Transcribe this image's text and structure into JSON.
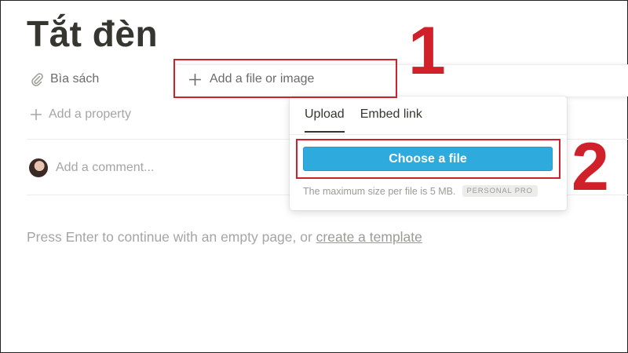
{
  "page": {
    "title": "Tắt đèn",
    "properties": {
      "files_label": "Bìa sách",
      "add_property_label": "Add a property"
    },
    "comment": {
      "placeholder": "Add a comment..."
    },
    "hint": {
      "text": "Press Enter to continue with an empty page, or ",
      "link_label": "create a template"
    }
  },
  "cover_menu": {
    "add_file_label": "Add a file or image"
  },
  "upload_popup": {
    "tabs": [
      {
        "label": "Upload",
        "active": true
      },
      {
        "label": "Embed link",
        "active": false
      }
    ],
    "button_label": "Choose a file",
    "note": "The maximum size per file is 5 MB.",
    "plan_badge": "PERSONAL PRO",
    "accent_color": "#2eaadc"
  },
  "annotations": {
    "step1": "1",
    "step2": "2",
    "highlight_color": "#d0212a"
  },
  "icons": {
    "attachment": "paperclip-icon",
    "plus": "plus-icon",
    "avatar": "avatar"
  }
}
